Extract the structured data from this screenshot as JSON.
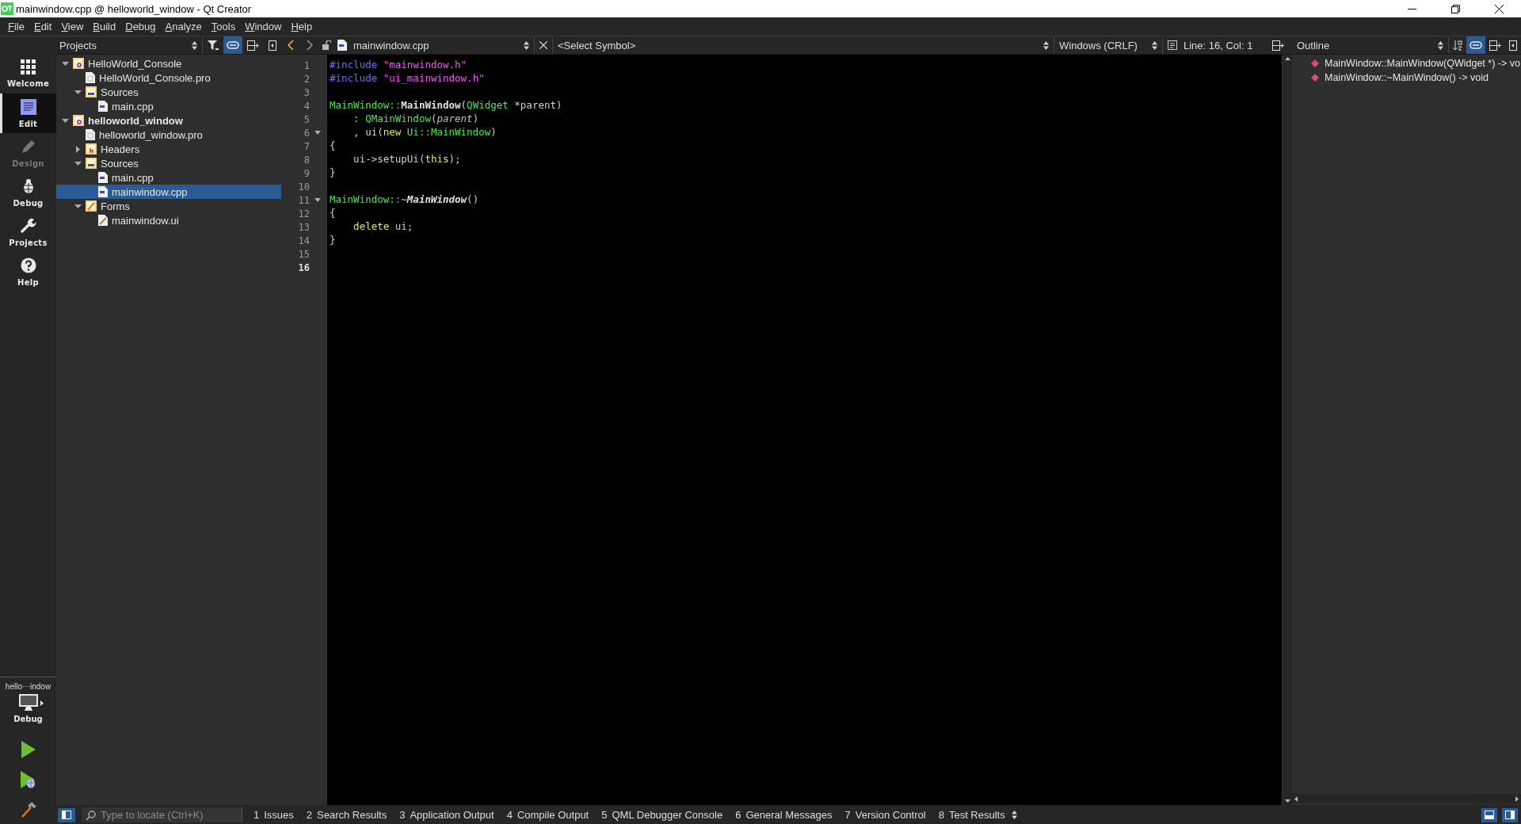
{
  "window": {
    "title": "mainwindow.cpp @ helloworld_window - Qt Creator"
  },
  "menu": [
    "File",
    "Edit",
    "View",
    "Build",
    "Debug",
    "Analyze",
    "Tools",
    "Window",
    "Help"
  ],
  "modes": [
    {
      "label": "Welcome",
      "kind": "welcome",
      "selected": false,
      "disabled": false
    },
    {
      "label": "Edit",
      "kind": "edit",
      "selected": true,
      "disabled": false
    },
    {
      "label": "Design",
      "kind": "design",
      "selected": false,
      "disabled": true
    },
    {
      "label": "Debug",
      "kind": "debug",
      "selected": false,
      "disabled": false
    },
    {
      "label": "Projects",
      "kind": "projects",
      "selected": false,
      "disabled": false
    },
    {
      "label": "Help",
      "kind": "help",
      "selected": false,
      "disabled": false
    }
  ],
  "kit": {
    "project": "hello⋯indow",
    "build": "Debug"
  },
  "projects_pane": {
    "title": "Projects",
    "linked": true
  },
  "tree": [
    {
      "label": "HelloWorld_Console",
      "kind": "project",
      "active": false,
      "expanded": true,
      "selected": false,
      "children": [
        {
          "label": "HelloWorld_Console.pro",
          "kind": "pro",
          "selected": false
        },
        {
          "label": "Sources",
          "kind": "sources",
          "expanded": true,
          "selected": false,
          "children": [
            {
              "label": "main.cpp",
              "kind": "cpp",
              "selected": false
            }
          ]
        }
      ]
    },
    {
      "label": "helloworld_window",
      "kind": "project",
      "active": true,
      "expanded": true,
      "selected": false,
      "children": [
        {
          "label": "helloworld_window.pro",
          "kind": "pro",
          "selected": false
        },
        {
          "label": "Headers",
          "kind": "headers",
          "expanded": false,
          "selected": false
        },
        {
          "label": "Sources",
          "kind": "sources",
          "expanded": true,
          "selected": false,
          "children": [
            {
              "label": "main.cpp",
              "kind": "cpp",
              "selected": false
            },
            {
              "label": "mainwindow.cpp",
              "kind": "cpp",
              "selected": true
            }
          ]
        },
        {
          "label": "Forms",
          "kind": "forms",
          "expanded": true,
          "selected": false,
          "children": [
            {
              "label": "mainwindow.ui",
              "kind": "ui",
              "selected": false
            }
          ]
        }
      ]
    }
  ],
  "editor_toolbar": {
    "file": "mainwindow.cpp",
    "symbol": "<Select Symbol>",
    "line_ending": "Windows (CRLF)",
    "position": "Line: 16, Col: 1"
  },
  "code": [
    {
      "number": "1",
      "fold": false,
      "current": false,
      "tokens": [
        {
          "text": "#include",
          "kind": "pre"
        },
        {
          "text": " \"mainwindow.h\"",
          "kind": "str"
        }
      ]
    },
    {
      "number": "2",
      "fold": false,
      "current": false,
      "tokens": [
        {
          "text": "#include",
          "kind": "pre"
        },
        {
          "text": " \"ui_mainwindow.h\"",
          "kind": "str"
        }
      ]
    },
    {
      "number": "3",
      "fold": false,
      "current": false
    },
    {
      "number": "4",
      "fold": false,
      "current": false,
      "tokens": [
        {
          "text": "MainWindow::",
          "kind": "type"
        },
        {
          "text": "MainWindow",
          "kind": "fn"
        },
        {
          "text": "(",
          "kind": "plain"
        },
        {
          "text": "QWidget",
          "kind": "type"
        },
        {
          "text": " *parent)",
          "kind": "plain"
        }
      ]
    },
    {
      "number": "5",
      "fold": false,
      "current": false,
      "tokens": [
        {
          "text": "    : ",
          "kind": "plain"
        },
        {
          "text": "QMainWindow",
          "kind": "type"
        },
        {
          "text": "(",
          "kind": "plain"
        },
        {
          "text": "parent",
          "kind": "param"
        },
        {
          "text": ")",
          "kind": "plain"
        }
      ]
    },
    {
      "number": "6",
      "fold": true,
      "current": false,
      "tokens": [
        {
          "text": "    , ui(",
          "kind": "plain"
        },
        {
          "text": "new",
          "kind": "kw"
        },
        {
          "text": " Ui::MainWindow",
          "kind": "type"
        },
        {
          "text": ")",
          "kind": "plain"
        }
      ]
    },
    {
      "number": "7",
      "fold": false,
      "current": false,
      "tokens": [
        {
          "text": "{",
          "kind": "plain"
        }
      ]
    },
    {
      "number": "8",
      "fold": false,
      "current": false,
      "tokens": [
        {
          "text": "    ui->setupUi(",
          "kind": "plain"
        },
        {
          "text": "this",
          "kind": "kw"
        },
        {
          "text": ");",
          "kind": "plain"
        }
      ]
    },
    {
      "number": "9",
      "fold": false,
      "current": false,
      "tokens": [
        {
          "text": "}",
          "kind": "plain"
        }
      ]
    },
    {
      "number": "10",
      "fold": false,
      "current": false
    },
    {
      "number": "11",
      "fold": true,
      "current": false,
      "tokens": [
        {
          "text": "MainWindow::",
          "kind": "type"
        },
        {
          "text": "~",
          "kind": "plain"
        },
        {
          "text": "MainWindow",
          "kind": "dtor"
        },
        {
          "text": "()",
          "kind": "plain"
        }
      ]
    },
    {
      "number": "12",
      "fold": false,
      "current": false,
      "tokens": [
        {
          "text": "{",
          "kind": "plain"
        }
      ]
    },
    {
      "number": "13",
      "fold": false,
      "current": false,
      "tokens": [
        {
          "text": "    delete",
          "kind": "kw"
        },
        {
          "text": " ui;",
          "kind": "plain"
        }
      ]
    },
    {
      "number": "14",
      "fold": false,
      "current": false,
      "tokens": [
        {
          "text": "}",
          "kind": "plain"
        }
      ]
    },
    {
      "number": "15",
      "fold": false,
      "current": false
    },
    {
      "number": "16",
      "fold": false,
      "current": true
    }
  ],
  "outline": {
    "title": "Outline",
    "linked": true,
    "items": [
      "MainWindow::MainWindow(QWidget *) -> vo",
      "MainWindow::~MainWindow() -> void"
    ]
  },
  "locator": {
    "placeholder": "Type to locate (Ctrl+K)"
  },
  "output_panes": [
    {
      "number": "1",
      "label": "Issues"
    },
    {
      "number": "2",
      "label": "Search Results"
    },
    {
      "number": "3",
      "label": "Application Output"
    },
    {
      "number": "4",
      "label": "Compile Output"
    },
    {
      "number": "5",
      "label": "QML Debugger Console"
    },
    {
      "number": "6",
      "label": "General Messages"
    },
    {
      "number": "7",
      "label": "Version Control"
    },
    {
      "number": "8",
      "label": "Test Results"
    }
  ]
}
